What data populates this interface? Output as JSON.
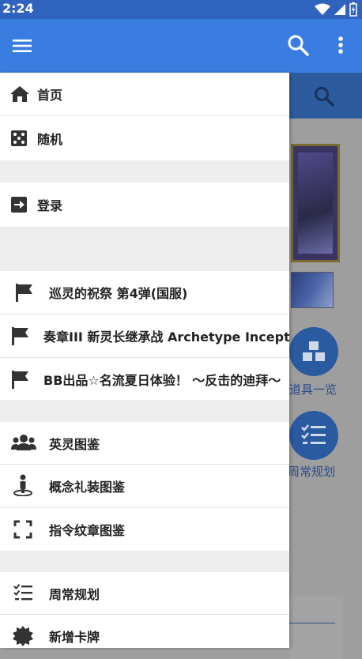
{
  "status_bar": {
    "time": "2:24"
  },
  "colors": {
    "app_bar": "#3a7de0",
    "status_bar": "#2f63bd",
    "drawer_bg": "#ffffff",
    "separator": "#eeeeee",
    "text": "#222222"
  },
  "app_bar": {
    "menu_icon": "hamburger-icon",
    "search_icon": "search-icon",
    "more_icon": "more-vert-icon"
  },
  "drawer": {
    "home": "首页",
    "random": "随机",
    "login": "登录",
    "events": [
      "巡灵的祝祭 第4弹(国服)",
      "奏章III 新灵长继承战 Archetype Inception(",
      "BB出品☆名流夏日体验！ 〜反击的迪拜〜"
    ],
    "servants": "英灵图鉴",
    "craft_essences": "概念礼装图鉴",
    "command_codes": "指令纹章图鉴",
    "daily_plan": "周常规划",
    "new_cards": "新增卡牌"
  },
  "background_page": {
    "items_label": "道具一览",
    "plan_label": "周常规划"
  }
}
